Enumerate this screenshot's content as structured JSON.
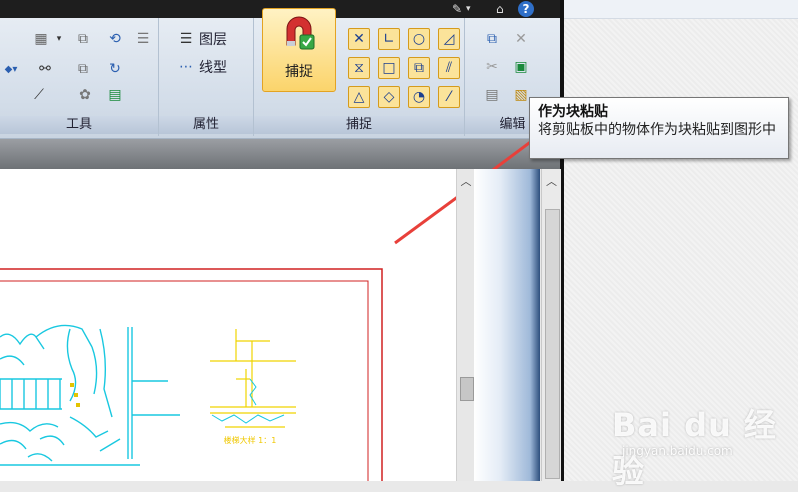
{
  "ribbon": {
    "panels": {
      "tools": {
        "title": "工具"
      },
      "properties": {
        "title": "属性",
        "layer_label": "图层",
        "linetype_label": "线型"
      },
      "snap": {
        "title": "捕捉",
        "big_button_label": "捕捉"
      },
      "edit": {
        "title": "编辑"
      }
    }
  },
  "tooltip": {
    "title": "作为块粘贴",
    "description": "将剪贴板中的物体作为块粘贴到图形中"
  },
  "drawing": {
    "caption": "楼梯大样 1：1"
  },
  "watermark": {
    "brand": "Bai du 经验",
    "url": "jingyan.baidu.com"
  },
  "colors": {
    "annotation_arrow": "#e8403a",
    "drawing_border": "#d02020",
    "drawing_lines_cyan": "#19c8e0",
    "drawing_lines_yellow": "#f0d400",
    "snap_highlight": "#fbd46b"
  }
}
